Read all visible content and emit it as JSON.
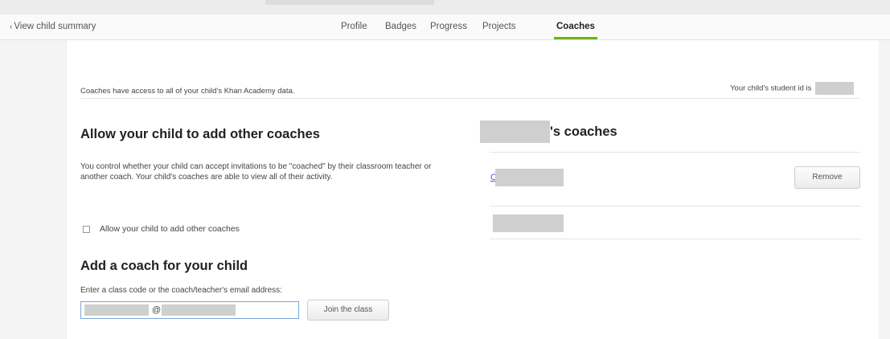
{
  "nav": {
    "back_link": "View child summary",
    "tabs": [
      {
        "label": "Profile"
      },
      {
        "label": "Badges"
      },
      {
        "label": "Progress"
      },
      {
        "label": "Projects"
      },
      {
        "label": "Coaches",
        "active": true
      }
    ]
  },
  "content": {
    "note": "Coaches have access to all of your child's Khan Academy data.",
    "student_id_label": "Your child's student id is",
    "allow_section": {
      "heading": "Allow your child to add other coaches",
      "description": "You control whether your child can accept invitations to be \"coached\" by their classroom teacher or another coach. Your child's coaches are able to view all of their activity.",
      "checkbox_label": "Allow your child to add other coaches",
      "checked": false
    },
    "add_section": {
      "heading": "Add a coach for your child",
      "input_label": "Enter a class code or the coach/teacher's email address:",
      "input_value_visible": "@",
      "join_button": "Join the class"
    },
    "coaches_section": {
      "heading_suffix": "'s coaches",
      "coach_1_initial": "C",
      "remove_button": "Remove"
    }
  },
  "colors": {
    "active_tab_underline": "#71b307",
    "link": "#4a62c8",
    "input_focus_border": "#7ba7d9"
  }
}
